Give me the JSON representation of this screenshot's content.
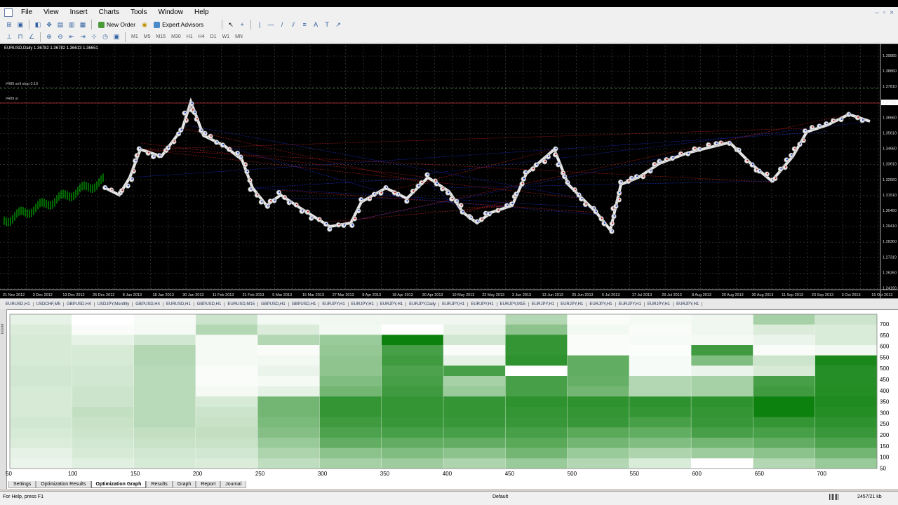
{
  "menu": [
    "File",
    "View",
    "Insert",
    "Charts",
    "Tools",
    "Window",
    "Help"
  ],
  "toolbar": {
    "new_order": "New Order",
    "expert_advisors": "Expert Advisors",
    "timeframes": [
      "M1",
      "M5",
      "M15",
      "M30",
      "H1",
      "H4",
      "D1",
      "W1",
      "MN"
    ]
  },
  "chart": {
    "title": "EURUSD,Daily  1.36782 1.36782 1.36613 1.36651",
    "order_label_1": "#489 sell stop 0.10",
    "order_label_2": "#489 sl",
    "price_labels": [
      "1.39885",
      "1.38860",
      "1.37810",
      "1.37785",
      "1.36660",
      "1.35610",
      "1.34660",
      "1.33610",
      "1.32560",
      "1.31510",
      "1.30460",
      "1.29410",
      "1.28360",
      "1.27310",
      "1.26260",
      "1.24190"
    ],
    "time_labels": [
      "21 Nov 2012",
      "3 Dec 2012",
      "13 Dec 2012",
      "26 Dec 2012",
      "8 Jan 2013",
      "18 Jan 2013",
      "30 Jan 2013",
      "11 Feb 2013",
      "21 Feb 2013",
      "5 Mar 2013",
      "15 Mar 2013",
      "27 Mar 2013",
      "8 Apr 2013",
      "18 Apr 2013",
      "30 Apr 2013",
      "10 May 2013",
      "22 May 2013",
      "3 Jun 2013",
      "13 Jun 2013",
      "25 Jun 2013",
      "5 Jul 2013",
      "17 Jul 2013",
      "29 Jul 2013",
      "8 Aug 2013",
      "20 Aug 2013",
      "30 Aug 2013",
      "11 Sep 2013",
      "23 Sep 2013",
      "3 Oct 2013",
      "15 Oct 2013"
    ]
  },
  "chart_tabs": [
    "EURUSD,H1",
    "USDCHF,M5",
    "GBPUSD,H4",
    "USDJPY,Monthly",
    "GBPUSD,H4",
    "EURUSD,H1",
    "GBPUSD,H1",
    "EURUSD,M15",
    "GBPUSD,H1",
    "GBPUSD,H1",
    "EURJPY,H1",
    "EURJPY,H1",
    "EURJPY,H1",
    "EURJPY,Daily",
    "EURJPY,H1",
    "EURJPY,H1",
    "EURJPY,M15",
    "EURJPY,H1",
    "EURJPY,H1",
    "EURJPY,H1",
    "EURJPY,H1",
    "EURJPY,H1",
    "EURJPY,H1"
  ],
  "optimization_graph": {
    "x_ticks": [
      "50",
      "100",
      "150",
      "200",
      "250",
      "300",
      "350",
      "400",
      "450",
      "500",
      "550",
      "600",
      "650",
      "700"
    ],
    "y_ticks": [
      "700",
      "650",
      "600",
      "550",
      "500",
      "450",
      "400",
      "350",
      "300",
      "250",
      "200",
      "150",
      "100",
      "50"
    ],
    "low_color": "#ffffff",
    "high_color": "#007a00",
    "intensity": [
      [
        0.1,
        0.0,
        0.03,
        0.2,
        0.05,
        0.06,
        0.06,
        0.06,
        0.3,
        0.02,
        0.04,
        0.06,
        0.35,
        0.2
      ],
      [
        0.14,
        0.02,
        0.04,
        0.3,
        0.14,
        0.05,
        0.0,
        0.1,
        0.45,
        0.05,
        0.02,
        0.06,
        0.14,
        0.15
      ],
      [
        0.16,
        0.1,
        0.18,
        0.04,
        0.3,
        0.4,
        0.95,
        0.18,
        0.8,
        0.02,
        0.03,
        0.04,
        0.08,
        0.15
      ],
      [
        0.16,
        0.16,
        0.3,
        0.04,
        0.02,
        0.42,
        0.72,
        0.02,
        0.8,
        0.02,
        0.01,
        0.75,
        0.02,
        0.05
      ],
      [
        0.16,
        0.16,
        0.3,
        0.04,
        0.05,
        0.44,
        0.75,
        0.1,
        0.82,
        0.62,
        0.03,
        0.5,
        0.2,
        0.9
      ],
      [
        0.18,
        0.18,
        0.28,
        0.02,
        0.08,
        0.44,
        0.7,
        0.72,
        0.0,
        0.62,
        0.03,
        0.08,
        0.16,
        0.85
      ],
      [
        0.18,
        0.18,
        0.28,
        0.02,
        0.04,
        0.5,
        0.72,
        0.35,
        0.72,
        0.6,
        0.3,
        0.35,
        0.72,
        0.85
      ],
      [
        0.16,
        0.2,
        0.28,
        0.04,
        0.1,
        0.55,
        0.75,
        0.4,
        0.72,
        0.55,
        0.3,
        0.35,
        0.75,
        0.86
      ],
      [
        0.16,
        0.2,
        0.28,
        0.16,
        0.55,
        0.8,
        0.8,
        0.8,
        0.82,
        0.82,
        0.82,
        0.82,
        0.95,
        0.88
      ],
      [
        0.16,
        0.24,
        0.28,
        0.2,
        0.55,
        0.8,
        0.8,
        0.8,
        0.8,
        0.8,
        0.8,
        0.8,
        0.95,
        0.86
      ],
      [
        0.18,
        0.22,
        0.28,
        0.22,
        0.52,
        0.75,
        0.78,
        0.78,
        0.78,
        0.78,
        0.72,
        0.78,
        0.8,
        0.82
      ],
      [
        0.16,
        0.2,
        0.24,
        0.24,
        0.48,
        0.7,
        0.72,
        0.72,
        0.72,
        0.65,
        0.62,
        0.72,
        0.72,
        0.78
      ],
      [
        0.14,
        0.18,
        0.22,
        0.22,
        0.4,
        0.62,
        0.62,
        0.62,
        0.65,
        0.55,
        0.5,
        0.55,
        0.62,
        0.7
      ],
      [
        0.1,
        0.16,
        0.18,
        0.18,
        0.32,
        0.45,
        0.5,
        0.45,
        0.55,
        0.4,
        0.32,
        0.38,
        0.45,
        0.55
      ],
      [
        0.08,
        0.12,
        0.16,
        0.14,
        0.25,
        0.35,
        0.38,
        0.32,
        0.4,
        0.3,
        0.15,
        0.0,
        0.3,
        0.4
      ]
    ]
  },
  "bottom_tabs": [
    "Settings",
    "Optimization Results",
    "Optimization Graph",
    "Results",
    "Graph",
    "Report",
    "Journal"
  ],
  "active_bottom_tab": "Optimization Graph",
  "side_strip_label": "Tester",
  "status": {
    "help": "For Help, press F1",
    "profile": "Default",
    "traffic": "2457/21 kb"
  }
}
